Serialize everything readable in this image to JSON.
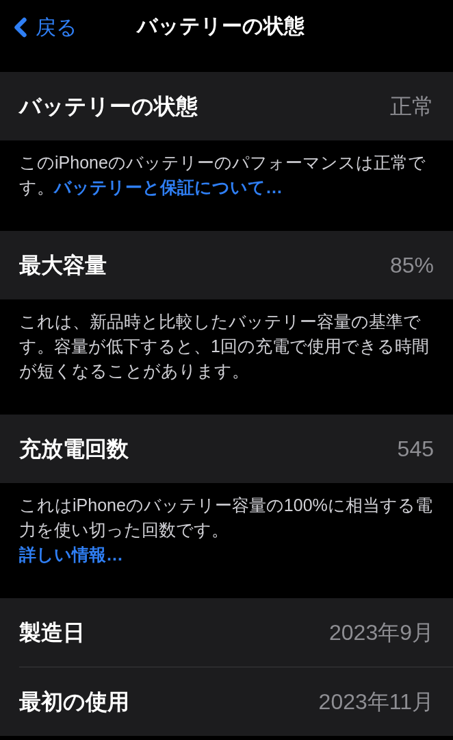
{
  "nav": {
    "back": "戻る",
    "title": "バッテリーの状態"
  },
  "sections": [
    {
      "rows": [
        {
          "label": "バッテリーの状態",
          "value": "正常"
        }
      ],
      "footer": {
        "kind": "inline",
        "text": "このiPhoneのバッテリーのパフォーマンスは正常です。",
        "link": "バッテリーと保証について…"
      }
    },
    {
      "rows": [
        {
          "label": "最大容量",
          "value": "85%"
        }
      ],
      "footer": {
        "text": "これは、新品時と比較したバッテリー容量の基準です。容量が低下すると、1回の充電で使用できる時間が短くなることがあります。"
      }
    },
    {
      "rows": [
        {
          "label": "充放電回数",
          "value": "545"
        }
      ],
      "footer": {
        "kind": "block",
        "text": "これはiPhoneのバッテリー容量の100%に相当する電力を使い切った回数です。",
        "link": "詳しい情報…"
      }
    },
    {
      "rows": [
        {
          "label": "製造日",
          "value": "2023年9月"
        },
        {
          "label": "最初の使用",
          "value": "2023年11月"
        }
      ]
    }
  ]
}
